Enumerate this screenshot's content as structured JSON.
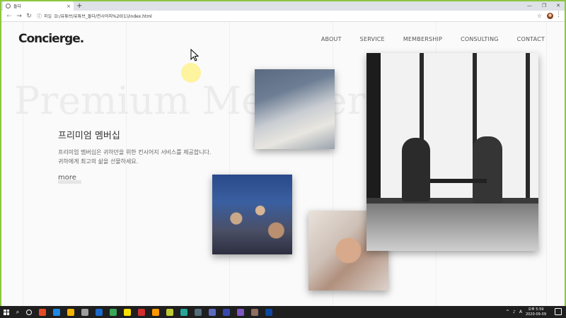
{
  "browser": {
    "tab_title": "돌다",
    "tab_close": "×",
    "new_tab": "+",
    "window_controls": [
      "—",
      "❐",
      "✕"
    ],
    "nav_back": "←",
    "nav_forward": "→",
    "reload": "↻",
    "info": "ⓘ",
    "scheme": "파일",
    "url": "D:/유튜브/유튜브_돌다/컨시어지%20(1)/index.html",
    "star": "☆",
    "menu": "⋮"
  },
  "site": {
    "logo": "Concierge.",
    "nav": [
      "ABOUT",
      "SERVICE",
      "MEMBERSHIP",
      "CONSULTING",
      "CONTACT"
    ],
    "hero_watermark": "Premium Membership",
    "section_title": "프리미엄 멤버십",
    "description_lines": [
      "프리미엄 멤버십은 귀하만을 위한 컨시어지 서비스를 제공합니다.",
      "귀하에게 최고의 삶을 선물하세요."
    ],
    "more": "more"
  },
  "taskbar": {
    "search": "⌕",
    "icon_colors": [
      "#e34c26",
      "#1e88e5",
      "#f4b400",
      "#9e9e9e",
      "#1b6ac9",
      "#3aa757",
      "#f9e000",
      "#d32f2f",
      "#ff9800",
      "#c0ca33",
      "#26a69a",
      "#546e7a",
      "#5c6bc0",
      "#3949ab",
      "#7e57c2",
      "#8d6e63",
      "#0d47a1"
    ],
    "ime": "A",
    "time": "오후 5:59",
    "date": "2020-09-09"
  }
}
